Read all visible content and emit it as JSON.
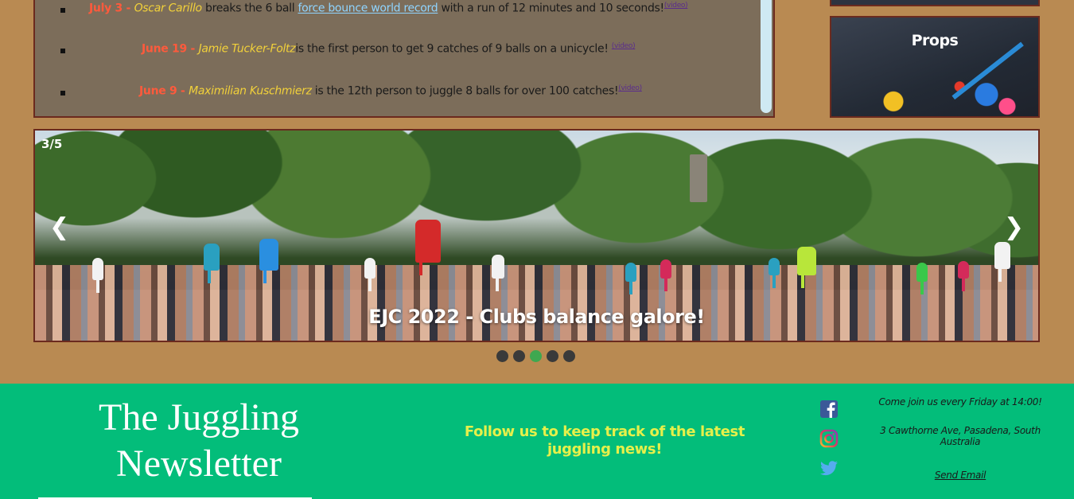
{
  "news": {
    "items": [
      {
        "date": "July 3 - ",
        "person": "Oscar Carillo",
        "text_before": " breaks the 6 ball ",
        "link": "force bounce world record",
        "text_after": " with a run of 12 minutes and 10 seconds!",
        "video": "(video)"
      },
      {
        "date": "June 19 - ",
        "person": "Jamie Tucker-Foltz",
        "text_before": "is the first person to get 9 catches of 9 balls on a unicycle! ",
        "video": "(video)"
      },
      {
        "date": "June 9 - ",
        "person": "Maximilian Kuschmierz",
        "text_before": " is the 12th person to juggle 8 balls for over 100 catches!",
        "video": "(video)"
      }
    ]
  },
  "props": {
    "title": "Props"
  },
  "carousel": {
    "counter": "3/5",
    "prev": "❮",
    "next": "❯",
    "caption": "EJC 2022 - Clubs balance galore!",
    "dots_count": 5,
    "active_dot": 3
  },
  "footer": {
    "title": "The Juggling Newsletter",
    "follow": "Follow us to keep track of the latest juggling news!",
    "social_icons": [
      "facebook-icon",
      "instagram-icon",
      "twitter-icon"
    ],
    "schedule": "Come join us every Friday at 14:00!",
    "address": "3 Cawthorne Ave, Pasadena, South Australia",
    "send_email": "Send Email"
  },
  "colors": {
    "background": "#b98a52",
    "footer": "#03bd7a",
    "date": "#ff5a3c",
    "person": "#f2d13a",
    "follow": "#e6f04a"
  }
}
